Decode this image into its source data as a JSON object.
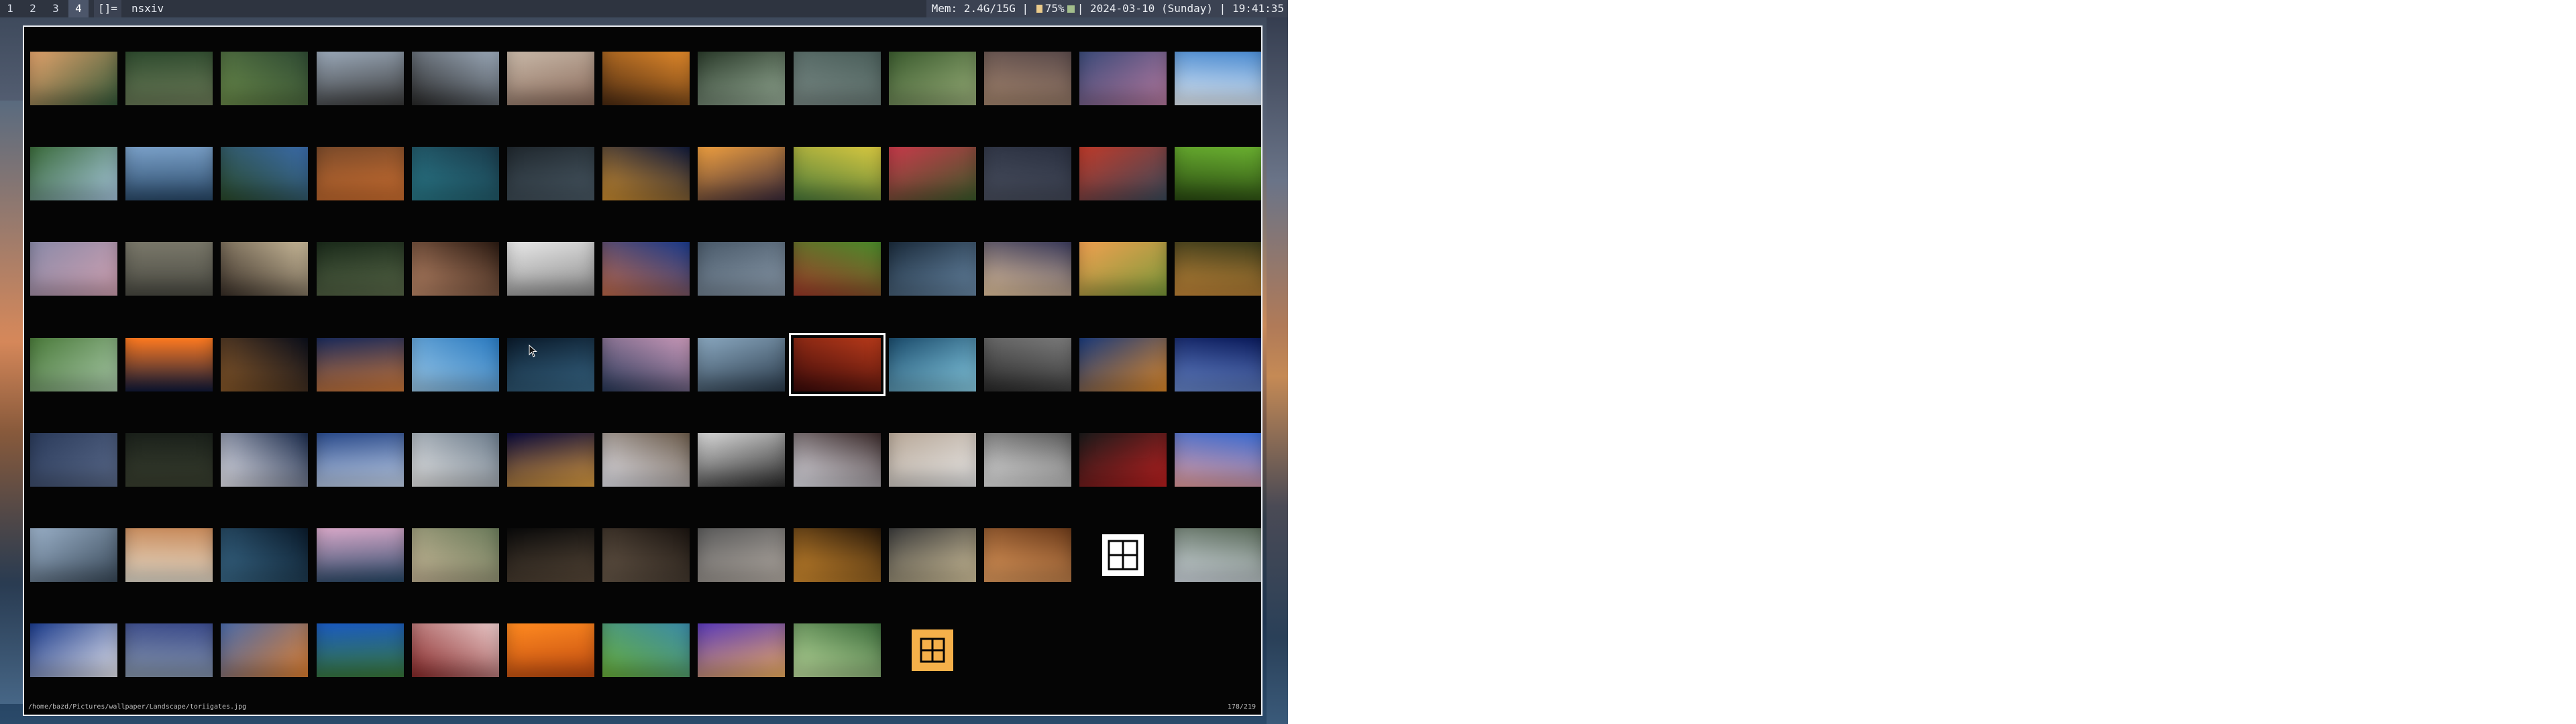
{
  "statusbar": {
    "tags": [
      "1",
      "2",
      "3",
      "4"
    ],
    "active_tag": "4",
    "layout_symbol": "[]=",
    "window_title": "nsxiv",
    "memory": "Mem: 2.4G/15G",
    "separator": "|",
    "battery": "75%",
    "datetime": "2024-03-10 (Sunday)",
    "time": "19:41:35"
  },
  "nsxiv": {
    "file_path": "/home/bazd/Pictures/wallpaper/Landscape/toriigates.jpg",
    "counter": "178/219",
    "thumbnails": [
      [
        "#e2a26b",
        "#355a3a",
        0
      ],
      [
        "#2e4a2e",
        "#6e7e5a",
        0
      ],
      [
        "#2f4a33",
        "#6a8a4a",
        0
      ],
      [
        "#9aa8b8",
        "#3a3a3a",
        0
      ],
      [
        "#9aa8b8",
        "#2a2a2a",
        0
      ],
      [
        "#c8b8a8",
        "#8a6a5a",
        0
      ],
      [
        "#e0882a",
        "#4a2a12",
        0
      ],
      [
        "#2a3a2a",
        "#9ab09a",
        0
      ],
      [
        "#4a5e5a",
        "#7a8a86",
        0
      ],
      [
        "#3a5a2e",
        "#9ab07a",
        0
      ],
      [
        "#5a4a4a",
        "#a88870",
        0
      ],
      [
        "#3a4a78",
        "#b87aa0",
        0
      ],
      [
        "#4a8ad0",
        "#e8f0f8",
        0
      ],
      [
        "#3a6a3a",
        "#a8c8e0",
        0
      ],
      [
        "#7aa0c8",
        "#2a4a6a",
        0
      ],
      [
        "#3a6aa8",
        "#2a4a2a",
        0
      ],
      [
        "#7a4a2a",
        "#d07030",
        0
      ],
      [
        "#1a3a4a",
        "#2a7a8a",
        0
      ],
      [
        "#20282e",
        "#4a5a66",
        0
      ],
      [
        "#101a3a",
        "#d09030",
        0
      ],
      [
        "#f0a040",
        "#3a2a3a",
        0
      ],
      [
        "#d8c840",
        "#4a7a3a",
        0
      ],
      [
        "#c83a4a",
        "#3a5a2a",
        0
      ],
      [
        "#2a3040",
        "#4a5060",
        0
      ],
      [
        "#c03a2a",
        "#3a4a5a",
        0
      ],
      [
        "#6ab030",
        "#2a4a12",
        0
      ],
      [
        "#8a8aa8",
        "#d0a0b0",
        0
      ],
      [
        "#7a786a",
        "#4a4a42",
        0
      ],
      [
        "#c8b898",
        "#3a3028",
        0
      ],
      [
        "#1a2a1a",
        "#5a6a4a",
        0
      ],
      [
        "#2a1a12",
        "#c08a6a",
        0
      ],
      [
        "#e8e8e8",
        "#8a8a8a",
        0
      ],
      [
        "#1a3a8a",
        "#c06a4a",
        0
      ],
      [
        "#4a5a6a",
        "#8a9aaa",
        0
      ],
      [
        "#4a8a2a",
        "#a03a2a",
        0
      ],
      [
        "#1a2a3a",
        "#6a8aa8",
        0
      ],
      [
        "#3a3a5a",
        "#e8c8a0",
        0
      ],
      [
        "#f0a050",
        "#7a9a3a",
        0
      ],
      [
        "#3a3a1a",
        "#c88a3a",
        0
      ],
      [
        "#4a7a3a",
        "#a8c8a8",
        0
      ],
      [
        "#ff7a20",
        "#101a3a",
        0
      ],
      [
        "#0a0e1a",
        "#8a5a2a",
        0
      ],
      [
        "#1a2a5a",
        "#d07a3a",
        0
      ],
      [
        "#2a7ac0",
        "#9ac8e8",
        0
      ],
      [
        "#0a1a2a",
        "#3a6a8a",
        0
      ],
      [
        "#c898b8",
        "#2a3a5a",
        0
      ],
      [
        "#8aa8c0",
        "#2a3a4a",
        0
      ],
      [
        "#b83a1a",
        "#3a0a0a",
        1
      ],
      [
        "#1a4a6a",
        "#8ad0e8",
        0
      ],
      [
        "#7a7a7a",
        "#2a2a2a",
        0
      ],
      [
        "#1a3a7a",
        "#e08a2a",
        0
      ],
      [
        "#0a1a5a",
        "#6a8ad0",
        0
      ],
      [
        "#2a3a5a",
        "#5a6a8a",
        0
      ],
      [
        "#1a201a",
        "#3a4030",
        0
      ],
      [
        "#1a2a4a",
        "#e8e8f0",
        0
      ],
      [
        "#2a4a8a",
        "#c8d8f0",
        0
      ],
      [
        "#6a7a8a",
        "#e8e8e8",
        0
      ],
      [
        "#0a0a3a",
        "#e0a040",
        0
      ],
      [
        "#6a5a4a",
        "#e8e8f0",
        0
      ],
      [
        "#d8d8d8",
        "#2a2a2a",
        0
      ],
      [
        "#3a2a2a",
        "#e8e8f0",
        0
      ],
      [
        "#b8a898",
        "#e8e8e8",
        0
      ],
      [
        "#5a5a5a",
        "#e8e8e8",
        0
      ],
      [
        "#1a1a1a",
        "#c02020",
        0
      ],
      [
        "#3a6ad0",
        "#e8a0a0",
        0
      ],
      [
        "#9ab0c8",
        "#3a4a5a",
        0
      ],
      [
        "#c88a5a",
        "#e8e0d0",
        0
      ],
      [
        "#0a1a2a",
        "#3a6a8a",
        0
      ],
      [
        "#d8a8c8",
        "#2a4a6a",
        0
      ],
      [
        "#6a7a5a",
        "#c8b898",
        0
      ],
      [
        "#0a0a0a",
        "#5a4a3a",
        0
      ],
      [
        "#1a1410",
        "#6a5a4a",
        0
      ],
      [
        "#5a5a5a",
        "#b8b0a8",
        0
      ],
      [
        "#2a1a0a",
        "#d89030",
        0
      ],
      [
        "#3a3a3a",
        "#d8c8a0",
        0
      ],
      [
        "#6a3a1a",
        "#e8a060",
        0
      ],
      [
        "icon-white",
        "",
        0
      ],
      [
        "#5a6a5a",
        "#d8e0e8",
        0
      ],
      [
        "#1a3a8a",
        "#e8e8f0",
        0
      ],
      [
        "#3a4a8a",
        "#8a9ab0",
        0
      ],
      [
        "#4a6aa8",
        "#e08030",
        0
      ],
      [
        "#1a5ac0",
        "#3a7a3a",
        0
      ],
      [
        "#e8c8c8",
        "#8a2a2a",
        0
      ],
      [
        "#ff8a20",
        "#c04a10",
        0
      ],
      [
        "#3a8aa8",
        "#6ab03a",
        0
      ],
      [
        "#5a3ab8",
        "#f0b060",
        0
      ],
      [
        "#3a6a3a",
        "#c0e0a0",
        0
      ],
      [
        "icon-orange",
        "",
        0
      ]
    ]
  },
  "colors": {
    "bar_bg": "#2e3440",
    "active_tag_bg": "#4c566a",
    "battery": "#ebcb8b",
    "network": "#a3be8c",
    "border": "#eceff4",
    "icon_orange": "#f5b04a"
  }
}
